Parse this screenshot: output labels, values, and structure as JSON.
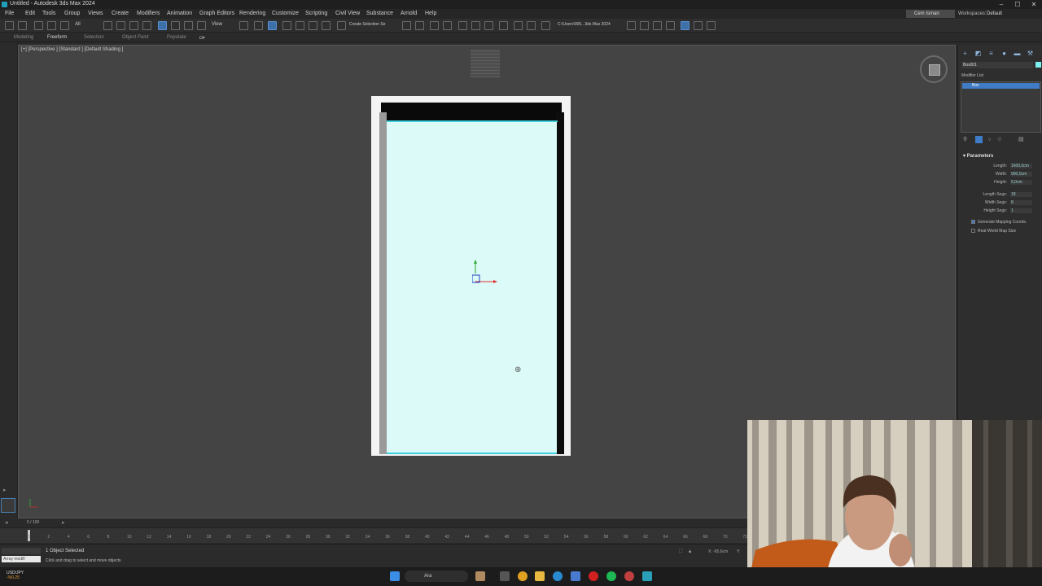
{
  "window": {
    "title": "Untitled - Autodesk 3ds Max 2024"
  },
  "menu": {
    "items": [
      "File",
      "Edit",
      "Tools",
      "Group",
      "Views",
      "Create",
      "Modifiers",
      "Animation",
      "Graph Editors",
      "Rendering",
      "Customize",
      "Scripting",
      "Civil View",
      "Substance",
      "Arnold",
      "Help"
    ],
    "user": "Cem Isman",
    "workspaces_label": "Workspaces:",
    "workspaces_value": "Default"
  },
  "toolbar": {
    "selection_filter": "All",
    "view_dropdown": "View",
    "named_selection": "Create Selection Se",
    "project_path": "C:\\Users\\905...3ds Max 2024"
  },
  "ribbon": {
    "tabs": [
      "Modeling",
      "Freeform",
      "Selection",
      "Object Paint",
      "Populate"
    ],
    "active": "Freeform"
  },
  "viewport": {
    "label": "[+] [Perspective ] [Standard ] [Default Shading ]"
  },
  "command_panel": {
    "object_name": "Box001",
    "modifier_list": "Modifier List",
    "stack_item": "Box",
    "rollout": "Parameters",
    "params": [
      {
        "label": "Length:",
        "value": "1600,0cm"
      },
      {
        "label": "Width:",
        "value": "900,0cm"
      },
      {
        "label": "Height:",
        "value": "5,0cm"
      },
      {
        "label": "Length Segs:",
        "value": "18"
      },
      {
        "label": "Width Segs:",
        "value": "8"
      },
      {
        "label": "Height Segs:",
        "value": "1"
      }
    ],
    "checkboxes": [
      {
        "label": "Generate Mapping Coords.",
        "checked": true
      },
      {
        "label": "Real-World Map Size",
        "checked": false
      }
    ],
    "selected_color": "#7ff0f0"
  },
  "timeline": {
    "frame_readout": "0 / 100",
    "ticks": [
      "0",
      "2",
      "4",
      "6",
      "8",
      "10",
      "12",
      "14",
      "16",
      "18",
      "20",
      "22",
      "24",
      "26",
      "28",
      "30",
      "32",
      "34",
      "36",
      "38",
      "40",
      "42",
      "44",
      "46",
      "48",
      "50",
      "52",
      "54",
      "56",
      "58",
      "60",
      "62",
      "64",
      "66",
      "68",
      "70",
      "72"
    ]
  },
  "status": {
    "maxscript": "Array modifi",
    "selection": "1 Object Selected",
    "prompt": "Click and drag to select and move objects",
    "x_readout": "X: -65,6cm",
    "y_readout": "Y:"
  },
  "taskbar": {
    "weather_title": "USD/JPY",
    "weather_sub": "-%0,25",
    "search": "Ara"
  }
}
